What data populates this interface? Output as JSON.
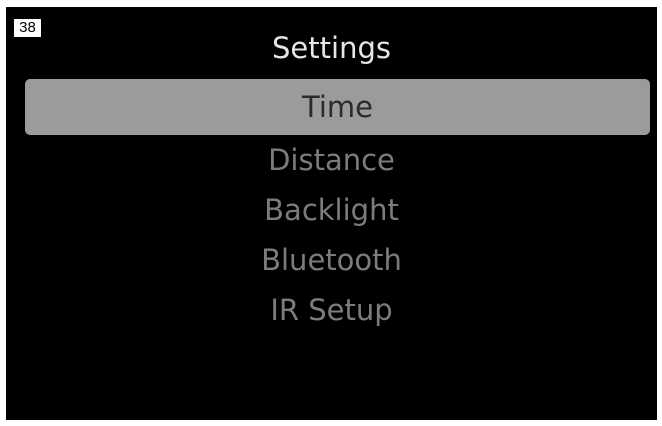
{
  "badge": {
    "label": "38"
  },
  "screen": {
    "title": "Settings"
  },
  "menu": {
    "selected_index": 0,
    "items": [
      {
        "label": "Time"
      },
      {
        "label": "Distance"
      },
      {
        "label": "Backlight"
      },
      {
        "label": "Bluetooth"
      },
      {
        "label": "IR Setup"
      }
    ]
  },
  "colors": {
    "background": "#000000",
    "title": "#e6e6e6",
    "item_text": "#7c7c7c",
    "selected_bg": "#9b9b9b",
    "selected_text": "#2b2b2b"
  }
}
